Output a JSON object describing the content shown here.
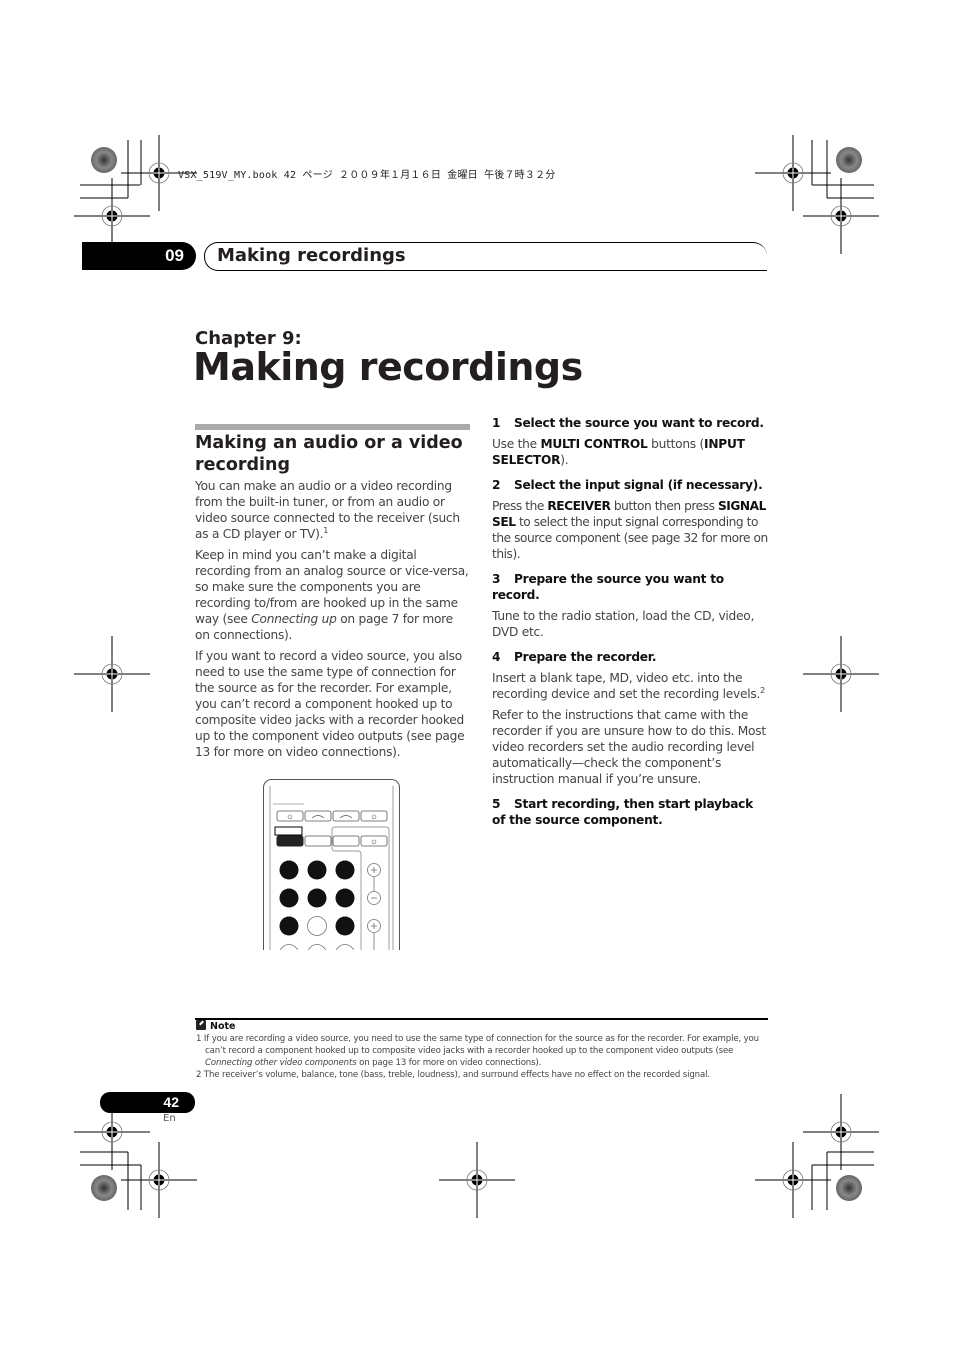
{
  "print_header": "VSX_519V_MY.book  42 ページ  ２００９年１月１６日  金曜日  午後７時３２分",
  "chapter_tab": {
    "number": "09",
    "title": "Making recordings"
  },
  "chapter": {
    "label": "Chapter 9:",
    "title": "Making recordings"
  },
  "section": {
    "title": "Making an audio or a video recording",
    "paragraphs": {
      "p1": "You can make an audio or a video recording from the built-in tuner, or from an audio or video source connected to the receiver (such as a CD player or TV).",
      "p1_sup": "1",
      "p2_before": "Keep in mind you can’t make a digital recording from an analog source or vice-versa, so make sure the components you are recording to/from are hooked up in the same way (see ",
      "p2_italic": "Connecting up",
      "p2_after": " on page 7 for more on connections).",
      "p3": "If you want to record a video source, you also need to use the same type of connection for the source as for the recorder. For example, you can’t record a component hooked up to composite video jacks with a recorder hooked up to the component video outputs (see page 13 for more on video connections)."
    }
  },
  "steps": [
    {
      "num": "1",
      "heading": "Select the source you want to record.",
      "t1": "Use the ",
      "b1": "MULTI CONTROL",
      "t2": " buttons (",
      "b2": "INPUT SELECTOR",
      "t3": ")."
    },
    {
      "num": "2",
      "heading": "Select the input signal (if necessary).",
      "t1": "Press the ",
      "b1": "RECEIVER",
      "t2": " button then press ",
      "b2": "SIGNAL SEL",
      "t3": " to select the input signal corresponding to the source component (see page 32 for more on this)."
    },
    {
      "num": "3",
      "heading": "Prepare the source you want to record.",
      "text": "Tune to the radio station, load the CD, video, DVD etc."
    },
    {
      "num": "4",
      "heading": "Prepare the recorder.",
      "text": "Insert a blank tape, MD, video etc. into the recording device and set the recording levels.",
      "sup": "2",
      "text2": "Refer to the instructions that came with the recorder if you are unsure how to do this. Most video recorders set the audio recording level automatically—check the component’s instruction manual if you’re unsure."
    },
    {
      "num": "5",
      "heading": "Start recording, then start playback of the source component."
    }
  ],
  "remote_illustration": {
    "icon": "remote-control-illustration"
  },
  "notes": {
    "heading": "Note",
    "fn1_before": "1 If you are recording a video source, you need to use the same type of connection for the source as for the recorder. For example, you can’t record a component hooked up to composite video jacks with a recorder hooked up to the component video outputs (see ",
    "fn1_italic": "Connecting other video components",
    "fn1_after": " on page 13 for more on video connections).",
    "fn2": "2 The receiver’s volume, balance, tone (bass, treble, loudness), and surround effects have no effect on the recorded signal."
  },
  "page": {
    "number": "42",
    "lang": "En"
  }
}
